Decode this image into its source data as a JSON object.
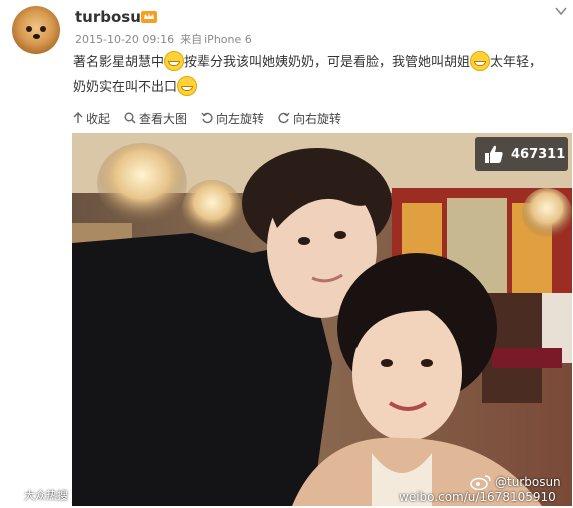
{
  "post": {
    "username": "turbosun",
    "timestamp": "2015-10-20 09:16",
    "source_prefix": "来自",
    "source": "iPhone 6",
    "text_part1": "著名影星胡慧中",
    "text_part2": "按辈分我该叫她姨奶奶，可是看脸，我管她叫胡姐",
    "text_part3": "太年轻，奶奶实在叫不出口"
  },
  "toolbar": {
    "collapse": "收起",
    "view_large": "查看大图",
    "rotate_left": "向左旋转",
    "rotate_right": "向右旋转"
  },
  "photo": {
    "like_count": "467311",
    "watermark_user": "@turbosun",
    "watermark_url": "weibo.com/u/1678105910",
    "watermark_left": "大众热搜"
  },
  "icons": {
    "avatar": "pomeranian-dog-avatar",
    "vip": "vip-crown-icon",
    "dropdown": "chevron-down-icon",
    "emoji": "grin-emoji",
    "like": "thumbs-up-icon"
  }
}
